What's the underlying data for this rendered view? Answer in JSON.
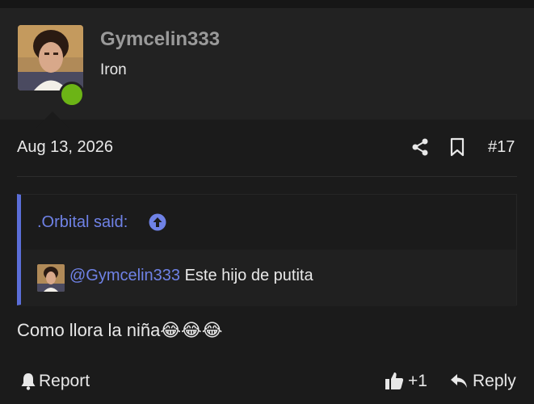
{
  "post": {
    "username": "Gymcelin333",
    "user_title": "Iron",
    "date": "Aug 13, 2026",
    "post_number": "#17",
    "quote": {
      "author_label": ".Orbital said:",
      "mention": "@Gymcelin333",
      "text": " Este hijo de putita"
    },
    "message": "Como llora la niña",
    "emojis": "😂😂😂",
    "actions": {
      "report": "Report",
      "like_count": "+1",
      "reply": "Reply"
    }
  },
  "icons": {
    "share": "share-icon",
    "bookmark": "bookmark-icon",
    "quote_up": "arrow-up-circle-icon",
    "report": "bell-icon",
    "like": "thumbs-up-icon",
    "reply": "reply-arrow-icon"
  },
  "colors": {
    "accent": "#6f82e6",
    "online": "#6cb416",
    "background": "#1b1b1b"
  }
}
